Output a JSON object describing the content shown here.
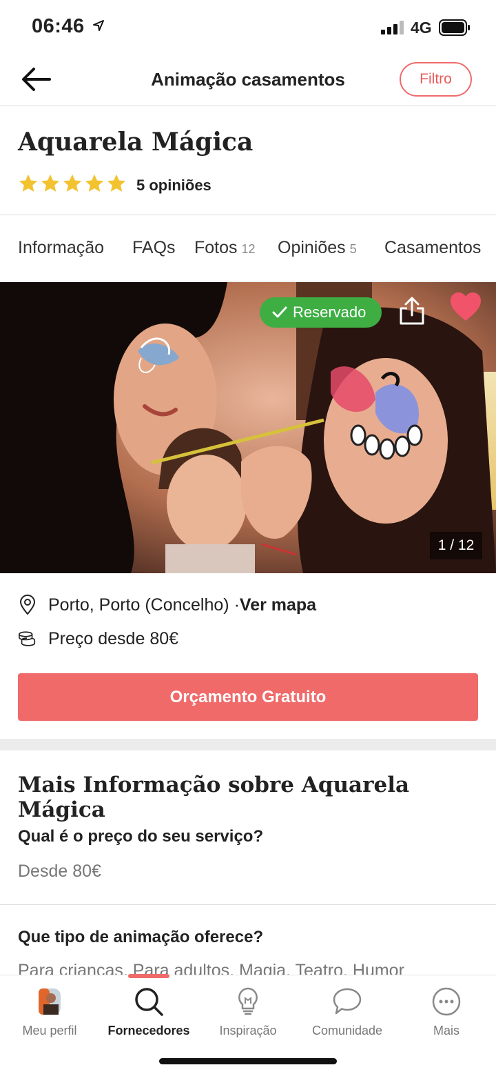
{
  "status_bar": {
    "time": "06:46",
    "network": "4G"
  },
  "nav": {
    "title": "Animação casamentos",
    "filter_label": "Filtro"
  },
  "vendor": {
    "name": "Aquarela Mágica",
    "rating_stars": 5,
    "reviews_label": "5 opiniões"
  },
  "tabs": [
    {
      "label": "Informação",
      "count": ""
    },
    {
      "label": "FAQs",
      "count": ""
    },
    {
      "label": "Fotos",
      "count": "12"
    },
    {
      "label": "Opiniões",
      "count": "5"
    },
    {
      "label": "Casamentos",
      "count": ""
    }
  ],
  "photo": {
    "badge": "Reservado",
    "counter": "1 / 12"
  },
  "location": {
    "text": "Porto, Porto (Concelho) · ",
    "link": "Ver mapa"
  },
  "price": {
    "text": "Preço desde 80€"
  },
  "cta": {
    "label": "Orçamento Gratuito"
  },
  "more_info": {
    "title": "Mais Informação sobre Aquarela Mágica",
    "questions": [
      {
        "question": "Qual é o preço do seu serviço?",
        "answer": "Desde 80€"
      },
      {
        "question": "Que tipo de animação oferece?",
        "answer": "Para crianças, Para adultos, Magia, Teatro, Humor"
      }
    ]
  },
  "bottom_tabs": [
    {
      "label": "Meu perfil",
      "icon": "avatar-icon"
    },
    {
      "label": "Fornecedores",
      "icon": "search-icon"
    },
    {
      "label": "Inspiração",
      "icon": "lightbulb-icon"
    },
    {
      "label": "Comunidade",
      "icon": "chat-bubble-icon"
    },
    {
      "label": "Mais",
      "icon": "more-icon"
    }
  ],
  "colors": {
    "accent": "#f06a6a",
    "reserved": "#3eae43",
    "star": "#f2c230"
  }
}
